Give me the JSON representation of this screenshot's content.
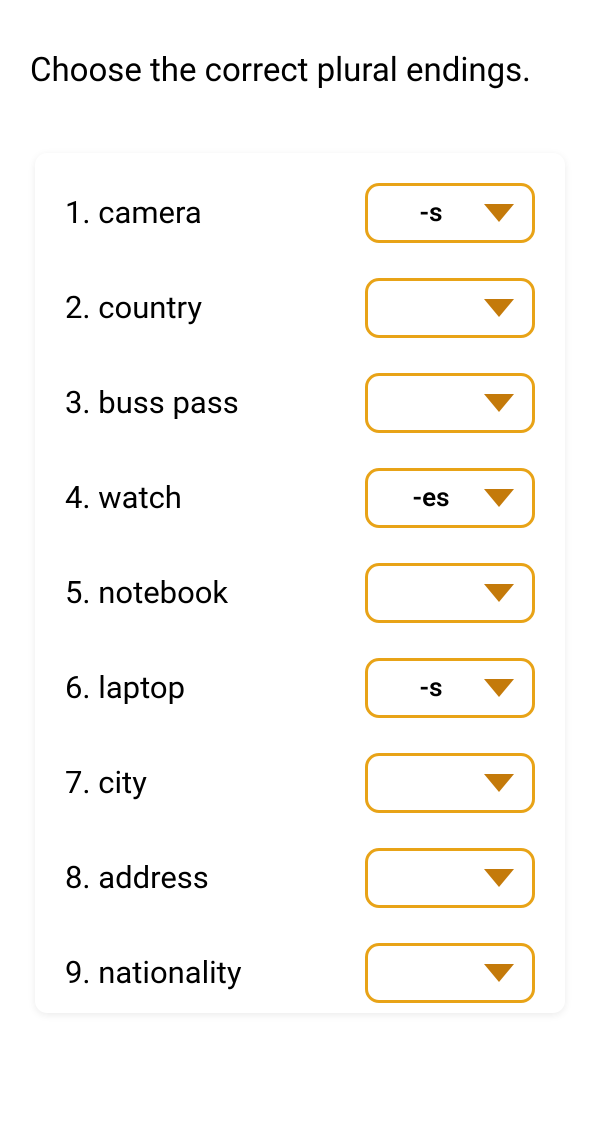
{
  "instruction": "Choose the correct plural endings.",
  "items": [
    {
      "label": "1. camera",
      "value": "-s"
    },
    {
      "label": "2. country",
      "value": ""
    },
    {
      "label": "3. buss pass",
      "value": ""
    },
    {
      "label": "4. watch",
      "value": "-es"
    },
    {
      "label": "5. notebook",
      "value": ""
    },
    {
      "label": "6. laptop",
      "value": "-s"
    },
    {
      "label": "7. city",
      "value": ""
    },
    {
      "label": "8. address",
      "value": ""
    },
    {
      "label": "9. nationality",
      "value": ""
    }
  ]
}
